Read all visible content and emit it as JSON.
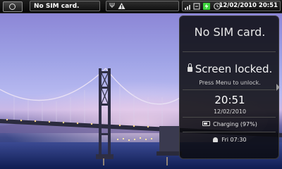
{
  "status_bar": {
    "carrier_label": "No SIM card.",
    "time_date": "12/02/2010 20:51",
    "icons": [
      "menu-circle-icon",
      "usb-icon",
      "warning-icon",
      "bars-icon",
      "sync-icon",
      "battery-charging-icon",
      "clock-icon"
    ]
  },
  "lock_screen": {
    "sim_status": "No SIM card.",
    "locked_title": "Screen locked.",
    "unlock_hint": "Press Menu to unlock.",
    "time": "20:51",
    "date": "12/02/2010",
    "charging": "Charging (97%)",
    "alarm": "Fri 07:30"
  },
  "colors": {
    "panel_bg": "#0a0a0e",
    "battery_green": "#3bd23b",
    "sky_purple": "#9fa3e6",
    "water_blue": "#1f2f6c"
  }
}
